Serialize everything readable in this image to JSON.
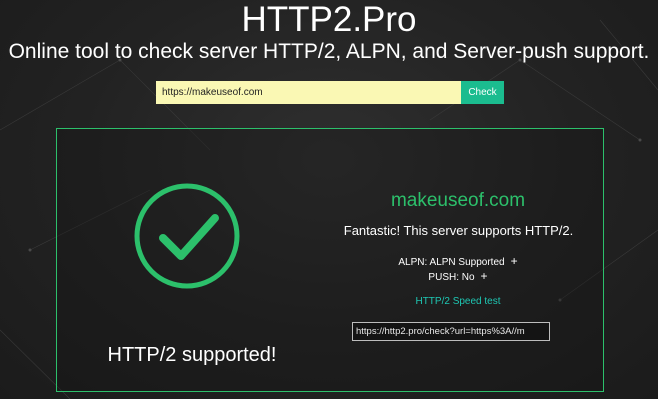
{
  "header": {
    "title": "HTTP2.Pro",
    "tagline": "Online tool to check server HTTP/2, ALPN, and Server-push support."
  },
  "search": {
    "value": "https://makeuseof.com",
    "button_label": "Check"
  },
  "result": {
    "status_icon": "check-circle-icon",
    "status_text": "HTTP/2 supported!",
    "domain": "makeuseof.com",
    "message": "Fantastic! This server supports HTTP/2.",
    "alpn_text": "ALPN: ALPN Supported",
    "push_text": "PUSH: No",
    "expand_symbol": "+",
    "speed_test_label": "HTTP/2 Speed test",
    "share_url": "https://http2.pro/check?url=https%3A//m"
  },
  "colors": {
    "accent_green": "#2cc06b",
    "button_teal": "#1bbc8f",
    "link_teal": "#1ec7b3",
    "input_yellow": "#faf8b4",
    "background": "#222222"
  }
}
